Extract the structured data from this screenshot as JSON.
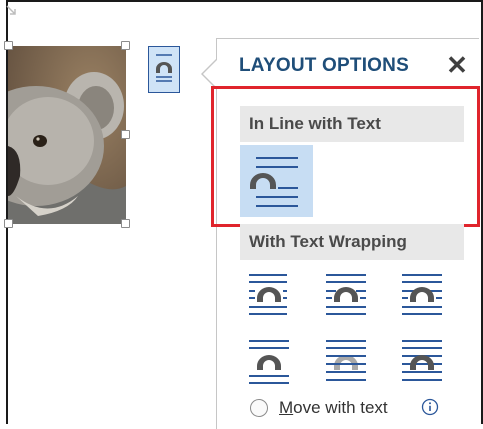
{
  "panel": {
    "title": "LAYOUT OPTIONS",
    "close_glyph": "✕",
    "inline_section": {
      "header": "In Line with Text",
      "options": [
        "in-line-with-text"
      ]
    },
    "wrap_section": {
      "header": "With Text Wrapping",
      "options": [
        "square",
        "tight",
        "through",
        "top-and-bottom",
        "behind-text",
        "in-front-of-text"
      ]
    },
    "move_with_text": {
      "mnemonic": "M",
      "rest": "ove with text",
      "checked": false
    }
  },
  "colors": {
    "accent": "#2b579a",
    "selected_bg": "#c7ddf3",
    "highlight": "#e0242c",
    "title": "#1f4e79",
    "header_bg": "#e8e8e8"
  },
  "icons": [
    "close-icon",
    "layout-options-icon",
    "info-icon",
    "radio-button"
  ]
}
